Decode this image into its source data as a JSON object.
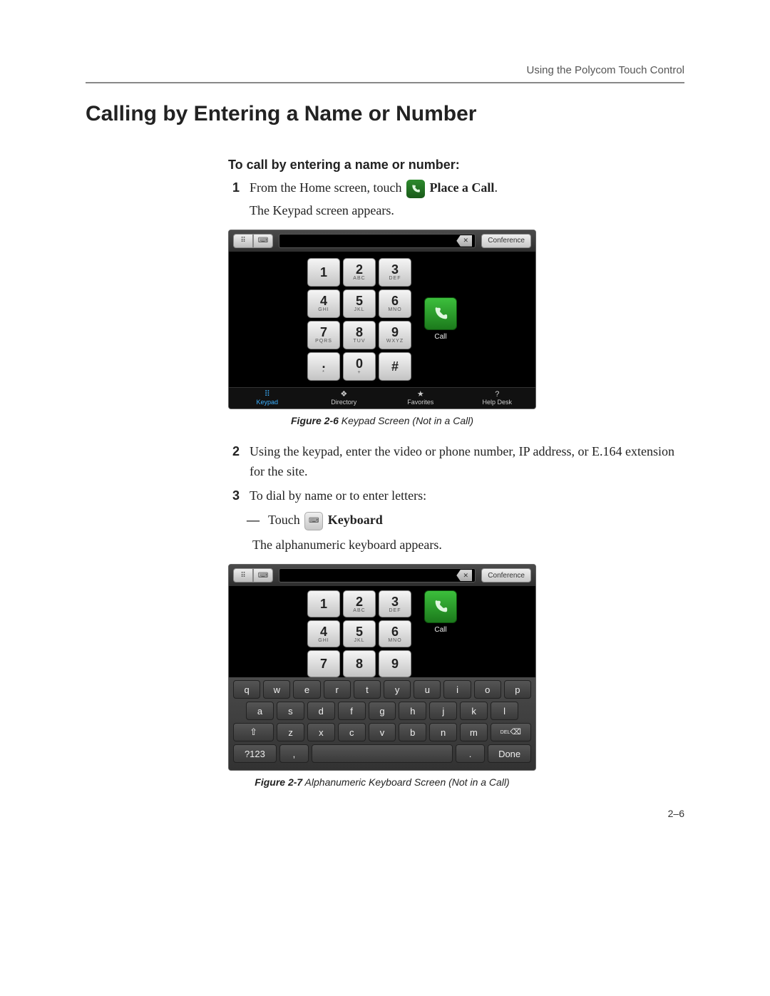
{
  "header": {
    "running": "Using the Polycom Touch Control"
  },
  "h1": "Calling by Entering a Name or Number",
  "h2": "To call by entering a name or number:",
  "step1": {
    "num": "1",
    "pre": "From the Home screen, touch ",
    "iconlabel": "Place a Call",
    "post": ".",
    "line2": "The Keypad screen appears."
  },
  "screen": {
    "conference": "Conference",
    "backspace": "✕",
    "call": "Call",
    "keys": [
      {
        "d": "1",
        "s": ""
      },
      {
        "d": "2",
        "s": "ABC"
      },
      {
        "d": "3",
        "s": "DEF"
      },
      {
        "d": "4",
        "s": "GHI"
      },
      {
        "d": "5",
        "s": "JKL"
      },
      {
        "d": "6",
        "s": "MNO"
      },
      {
        "d": "7",
        "s": "PQRS"
      },
      {
        "d": "8",
        "s": "TUV"
      },
      {
        "d": "9",
        "s": "WXYZ"
      },
      {
        "d": ".",
        "s": "*"
      },
      {
        "d": "0",
        "s": "+"
      },
      {
        "d": "#",
        "s": ""
      }
    ],
    "tabs": [
      {
        "ic": "⠿",
        "label": "Keypad",
        "sel": true
      },
      {
        "ic": "❖",
        "label": "Directory",
        "sel": false
      },
      {
        "ic": "★",
        "label": "Favorites",
        "sel": false
      },
      {
        "ic": "?",
        "label": "Help Desk",
        "sel": false
      }
    ]
  },
  "caption1_a": "Figure 2-6",
  "caption1_b": "  Keypad Screen (Not in a Call)",
  "step2": {
    "num": "2",
    "text": "Using the keypad, enter the video or phone number, IP address, or E.164 extension for the site."
  },
  "step3": {
    "num": "3",
    "text": "To dial by name or to enter letters:",
    "bullet_pre": "Touch ",
    "bullet_bold": "Keyboard",
    "after": "The alphanumeric keyboard appears."
  },
  "screen2_keys_short": [
    {
      "d": "1",
      "s": ""
    },
    {
      "d": "2",
      "s": "ABC"
    },
    {
      "d": "3",
      "s": "DEF"
    },
    {
      "d": "4",
      "s": "GHI"
    },
    {
      "d": "5",
      "s": "JKL"
    },
    {
      "d": "6",
      "s": "MNO"
    },
    {
      "d": "7",
      "s": ""
    },
    {
      "d": "8",
      "s": ""
    },
    {
      "d": "9",
      "s": ""
    }
  ],
  "qwerty": {
    "row1": [
      "q",
      "w",
      "e",
      "r",
      "t",
      "y",
      "u",
      "i",
      "o",
      "p"
    ],
    "row2": [
      "a",
      "s",
      "d",
      "f",
      "g",
      "h",
      "j",
      "k",
      "l"
    ],
    "row3_shift": "⇧",
    "row3": [
      "z",
      "x",
      "c",
      "v",
      "b",
      "n",
      "m"
    ],
    "row3_del": "⌫",
    "row3_del_sub": "DEL",
    "row4_sym": "?123",
    "row4_comma": ",",
    "row4_space": "␣",
    "row4_dot": ".",
    "row4_done": "Done"
  },
  "caption2_a": "Figure 2-7",
  "caption2_b": "  Alphanumeric Keyboard Screen (Not in a Call)",
  "pagefoot": "2–6"
}
